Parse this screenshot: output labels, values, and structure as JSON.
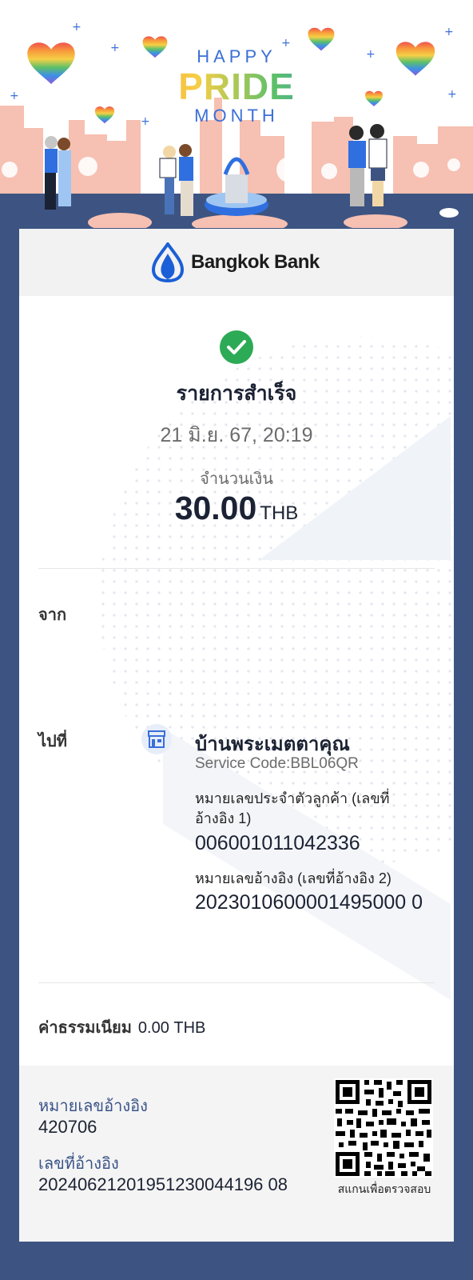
{
  "banner": {
    "happy": "HAPPY",
    "pride": "PRIDE",
    "month": "MONTH"
  },
  "brand": {
    "name": "Bangkok Bank",
    "logo_icon": "lotus-drop-icon",
    "color": "#1a5fd6"
  },
  "status": {
    "icon": "check-circle-icon",
    "text": "รายการสำเร็จ",
    "color": "#2daa55"
  },
  "datetime": "21 มิ.ย. 67, 20:19",
  "amount": {
    "label": "จำนวนเงิน",
    "value": "30.00",
    "currency": "THB"
  },
  "from": {
    "label": "จาก"
  },
  "to": {
    "label": "ไปที่",
    "icon": "store-icon",
    "name": "บ้านพระเมตตาคุณ",
    "service_code": "Service Code:BBL06QR",
    "ref1_label": "หมายเลขประจำตัวลูกค้า (เลขที่อ้างอิง 1)",
    "ref1_value": "006001011042336",
    "ref2_label": "หมายเลขอ้างอิง (เลขที่อ้างอิง 2)",
    "ref2_value": "2023010600001495000 0"
  },
  "fee": {
    "label": "ค่าธรรมเนียม",
    "value": "0.00 THB"
  },
  "footer": {
    "ref_label": "หมายเลขอ้างอิง",
    "ref_value": "420706",
    "txn_label": "เลขที่อ้างอิง",
    "txn_value": "20240621201951230044196 08",
    "qr_caption": "สแกนเพื่อตรวจสอบ",
    "qr_icon": "qr-code-icon"
  },
  "colors": {
    "page_background": "#3d5482",
    "accent_blue": "#3b5489"
  }
}
